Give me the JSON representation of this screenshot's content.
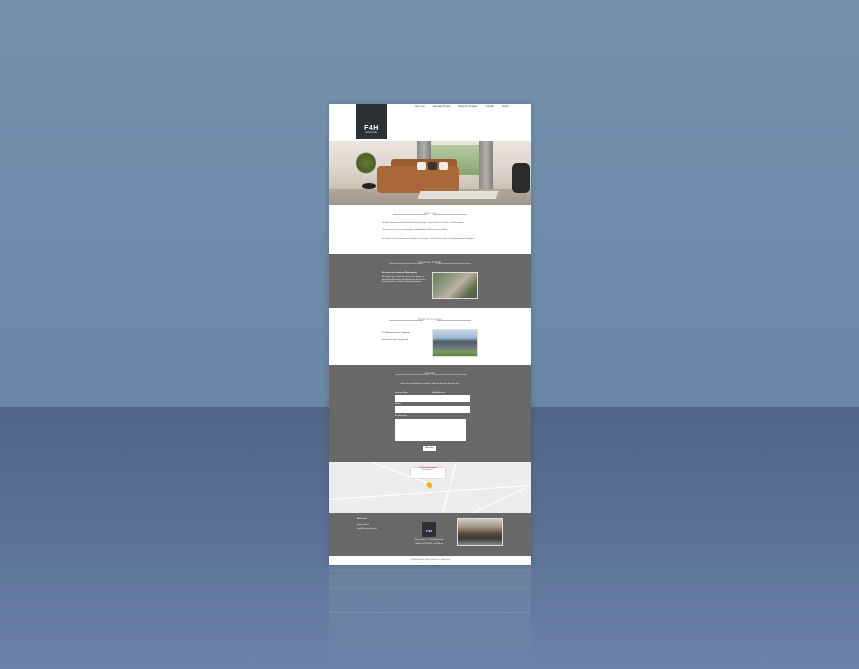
{
  "logo": {
    "main": "F4H",
    "sub": "ENTWICKLUNG"
  },
  "nav": [
    {
      "label": "Über uns"
    },
    {
      "label": "Aktuelles Projekt"
    },
    {
      "label": "Referenz Projekte"
    },
    {
      "label": "Kontakt"
    },
    {
      "label": "Suche"
    }
  ],
  "about": {
    "title": "Über uns",
    "p1": "Herzlich willkommen bei der F4H Entwicklung GmbH – Ihrem Partner für Wohn- und Gewerbebau.",
    "p2": "Unser Anspruch ist es, hochwertigen und bezahlbaren Wohnraum zu schaffen.",
    "p3": "Seit vielen Jahren realisieren wir Projekte in der Region – von der Planung bis zur schlüsselfertigen Übergabe."
  },
  "current_project": {
    "title": "Aktuelles Projekt",
    "heading": "Ein neues und modernes Wohnquartier",
    "text": "Mit Tiefgarage, Grünflächen und kurzen Wegen zu Einkaufsmöglichkeiten und öffentlichem Nahverkehr. Jetzt informieren und Wunschwohnung sichern."
  },
  "reference_project": {
    "title": "Referenz Projekte",
    "heading": "17 Wohneinheiten mit Tiefgarage",
    "text": "Mehrfamilienhaus, fertiggestellt"
  },
  "contact": {
    "title": "Kontakt",
    "intro": "Wenn Sie uns kontaktieren möchten, füllen Sie bitte das Formular aus.",
    "name_label": "Vorname Name",
    "email_label": "E-Mail-Adresse",
    "subject_label": "Betreff",
    "message_label": "Ihre Nachricht",
    "submit_label": "Absenden"
  },
  "map": {
    "place": "F4H Entwicklung GmbH",
    "address": "Musterstraße 1"
  },
  "footer": {
    "col1_title": "F4H GmbH",
    "col1_line1": "Musterstraße 1",
    "col1_line2": "info@f4h-entwicklung.de",
    "logo_text": "F4H",
    "address_line1": "Musterstraße 1 · 12345 Musterstadt",
    "address_line2": "Telefon 0123 456789 · info@f4h.de",
    "copyright": "© F4H Entwicklung GmbH · Impressum · Datenschutz"
  }
}
